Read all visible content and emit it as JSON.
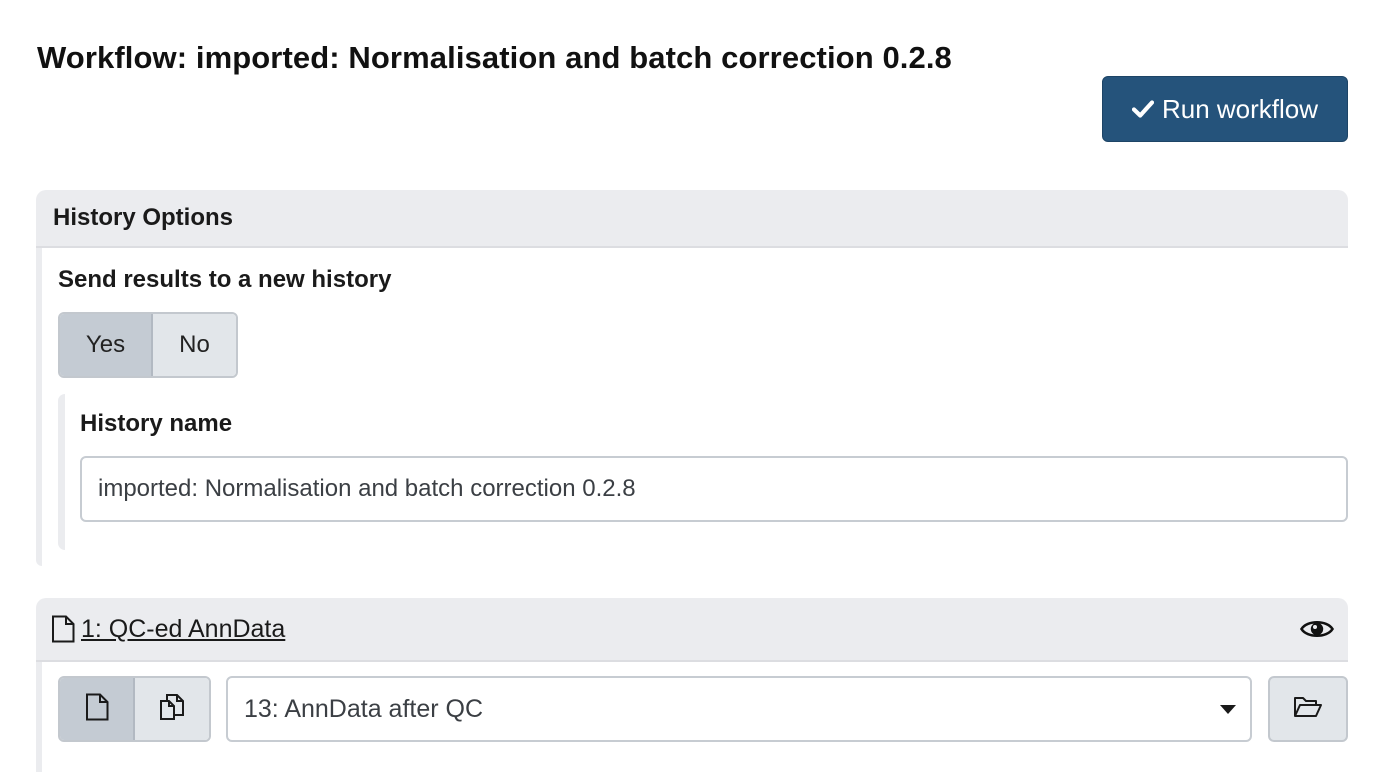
{
  "header": {
    "title": "Workflow: imported: Normalisation and batch correction 0.2.8",
    "run_button_label": "Run workflow",
    "run_button_icon": "check-icon",
    "run_button_color": "#25537b"
  },
  "history_options": {
    "title": "History Options",
    "send_results_label": "Send results to a new history",
    "toggle": {
      "yes_label": "Yes",
      "no_label": "No",
      "selected": "Yes"
    },
    "history_name_label": "History name",
    "history_name_value": "imported: Normalisation and batch correction 0.2.8"
  },
  "input_step": {
    "title": "1: QC-ed AnnData",
    "title_icon": "file-icon",
    "visibility_icon": "eye-icon",
    "mode_buttons": [
      {
        "icon": "single-dataset-icon",
        "selected": true
      },
      {
        "icon": "multiple-datasets-icon",
        "selected": false
      }
    ],
    "selected_dataset": "13: AnnData after QC",
    "browse_icon": "folder-open-icon"
  }
}
